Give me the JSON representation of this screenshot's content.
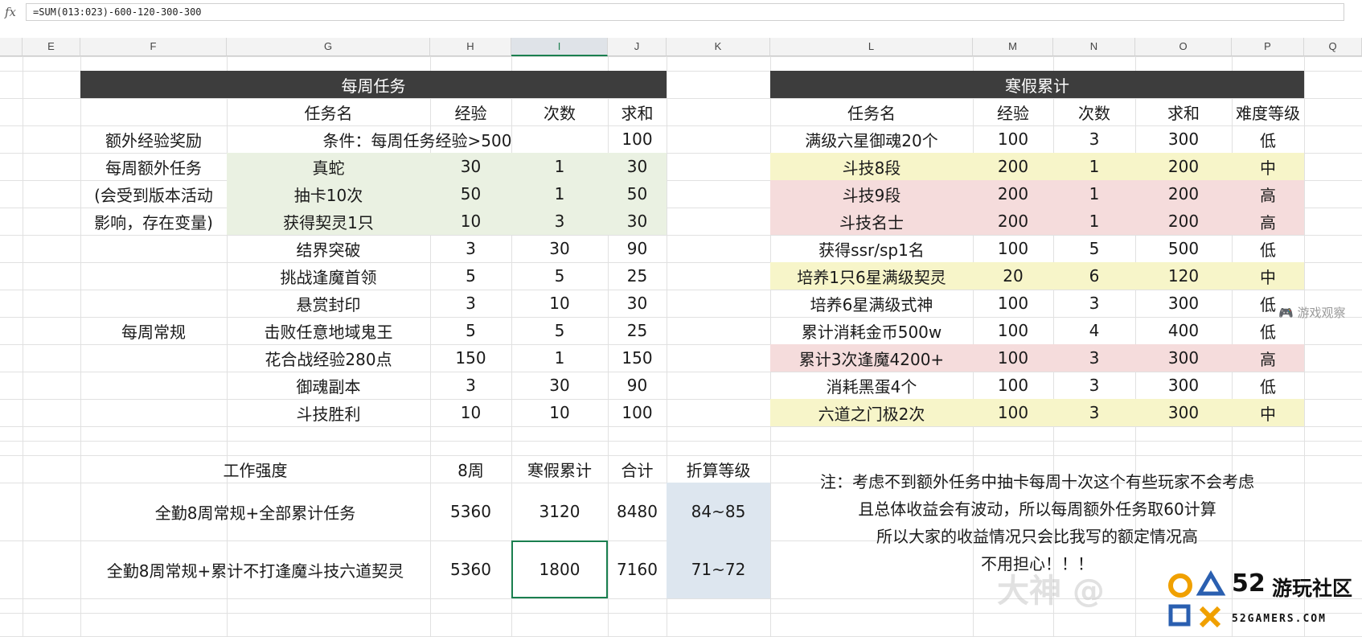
{
  "formula_bar": {
    "fx_label": "fx",
    "formula": "=SUM(013:023)-600-120-300-300"
  },
  "columns": [
    "E",
    "F",
    "G",
    "H",
    "I",
    "J",
    "K",
    "L",
    "M",
    "N",
    "O",
    "P",
    "Q"
  ],
  "weekly": {
    "title": "每周任务",
    "headers": {
      "task": "任务名",
      "exp": "经验",
      "count": "次数",
      "sum": "求和"
    },
    "bonus": {
      "label": "额外经验奖励",
      "condition": "条件：每周任务经验>500",
      "sum": "100"
    },
    "extra_group_label": [
      "每周额外任务",
      "(会受到版本活动",
      "影响，存在变量)"
    ],
    "extra_rows": [
      {
        "task": "真蛇",
        "exp": "30",
        "count": "1",
        "sum": "30"
      },
      {
        "task": "抽卡10次",
        "exp": "50",
        "count": "1",
        "sum": "50"
      },
      {
        "task": "获得契灵1只",
        "exp": "10",
        "count": "3",
        "sum": "30"
      }
    ],
    "routine_label": "每周常规",
    "routine_rows": [
      {
        "task": "结界突破",
        "exp": "3",
        "count": "30",
        "sum": "90"
      },
      {
        "task": "挑战逢魔首领",
        "exp": "5",
        "count": "5",
        "sum": "25"
      },
      {
        "task": "悬赏封印",
        "exp": "3",
        "count": "10",
        "sum": "30"
      },
      {
        "task": "击败任意地域鬼王",
        "exp": "5",
        "count": "5",
        "sum": "25"
      },
      {
        "task": "花合战经验280点",
        "exp": "150",
        "count": "1",
        "sum": "150"
      },
      {
        "task": "御魂副本",
        "exp": "3",
        "count": "30",
        "sum": "90"
      },
      {
        "task": "斗技胜利",
        "exp": "10",
        "count": "10",
        "sum": "100"
      }
    ]
  },
  "winter": {
    "title": "寒假累计",
    "headers": {
      "task": "任务名",
      "exp": "经验",
      "count": "次数",
      "sum": "求和",
      "level": "难度等级"
    },
    "rows": [
      {
        "task": "满级六星御魂20个",
        "exp": "100",
        "count": "3",
        "sum": "300",
        "level": "低",
        "tone": "white"
      },
      {
        "task": "斗技8段",
        "exp": "200",
        "count": "1",
        "sum": "200",
        "level": "中",
        "tone": "yellow"
      },
      {
        "task": "斗技9段",
        "exp": "200",
        "count": "1",
        "sum": "200",
        "level": "高",
        "tone": "pink"
      },
      {
        "task": "斗技名士",
        "exp": "200",
        "count": "1",
        "sum": "200",
        "level": "高",
        "tone": "pink"
      },
      {
        "task": "获得ssr/sp1名",
        "exp": "100",
        "count": "5",
        "sum": "500",
        "level": "低",
        "tone": "white"
      },
      {
        "task": "培养1只6星满级契灵",
        "exp": "20",
        "count": "6",
        "sum": "120",
        "level": "中",
        "tone": "yellow"
      },
      {
        "task": "培养6星满级式神",
        "exp": "100",
        "count": "3",
        "sum": "300",
        "level": "低",
        "tone": "white"
      },
      {
        "task": "累计消耗金币500w",
        "exp": "100",
        "count": "4",
        "sum": "400",
        "level": "低",
        "tone": "white"
      },
      {
        "task": "累计3次逢魔4200+",
        "exp": "100",
        "count": "3",
        "sum": "300",
        "level": "高",
        "tone": "pink"
      },
      {
        "task": "消耗黑蛋4个",
        "exp": "100",
        "count": "3",
        "sum": "300",
        "level": "低",
        "tone": "white"
      },
      {
        "task": "六道之门极2次",
        "exp": "100",
        "count": "3",
        "sum": "300",
        "level": "中",
        "tone": "yellow"
      }
    ]
  },
  "summary": {
    "headers": {
      "intensity": "工作强度",
      "weeks": "8周",
      "winter": "寒假累计",
      "total": "合计",
      "grade": "折算等级"
    },
    "rows": [
      {
        "label": "全勤8周常规+全部累计任务",
        "weeks": "5360",
        "winter": "3120",
        "total": "8480",
        "grade": "84~85"
      },
      {
        "label": "全勤8周常规+累计不打逢魔斗技六道契灵",
        "weeks": "5360",
        "winter": "1800",
        "total": "7160",
        "grade": "71~72"
      }
    ]
  },
  "note": [
    "注：考虑不到额外任务中抽卡每周十次这个有些玩家不会考虑",
    "且总体收益会有波动，所以每周额外任务取60计算",
    "所以大家的收益情况只会比我写的额定情况高",
    "不用担心！！！"
  ],
  "watermarks": {
    "site_cn": "游戏观察",
    "overlay": "大神 @",
    "logo_num": "52",
    "logo_cn": "游玩社区",
    "logo_en": "52GAMERS.COM"
  },
  "colors": {
    "header_dark": "#3d3d3d",
    "green": "#eaf1e2",
    "yellow": "#f7f5c9",
    "pink": "#f5dcdc",
    "blue": "#dde6ef",
    "selection": "#1a7f4f"
  }
}
